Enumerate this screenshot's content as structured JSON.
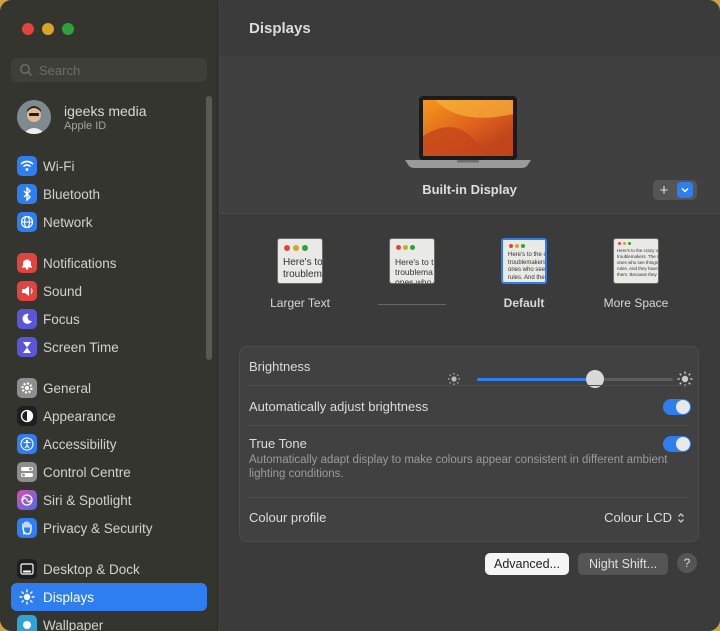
{
  "sidebar": {
    "search_placeholder": "Search",
    "account": {
      "name": "igeeks media",
      "subtitle": "Apple ID"
    },
    "groups": [
      [
        {
          "label": "Wi-Fi",
          "icon": "wifi-icon",
          "color": "#2f7ef0"
        },
        {
          "label": "Bluetooth",
          "icon": "bluetooth-icon",
          "color": "#2f7ef0"
        },
        {
          "label": "Network",
          "icon": "globe-icon",
          "color": "#2f7ef0"
        }
      ],
      [
        {
          "label": "Notifications",
          "icon": "bell-icon",
          "color": "#e0443e"
        },
        {
          "label": "Sound",
          "icon": "speaker-icon",
          "color": "#e0443e"
        },
        {
          "label": "Focus",
          "icon": "moon-icon",
          "color": "#5b55d8"
        },
        {
          "label": "Screen Time",
          "icon": "hourglass-icon",
          "color": "#5b55d8"
        }
      ],
      [
        {
          "label": "General",
          "icon": "gear-icon",
          "color": "#8e8e8e"
        },
        {
          "label": "Appearance",
          "icon": "appearance-icon",
          "color": "#1f1f1f"
        },
        {
          "label": "Accessibility",
          "icon": "accessibility-icon",
          "color": "#2f7ef0"
        },
        {
          "label": "Control Centre",
          "icon": "switches-icon",
          "color": "#8e8e8e"
        },
        {
          "label": "Siri & Spotlight",
          "icon": "siri-icon",
          "color": "#b44bd6"
        },
        {
          "label": "Privacy & Security",
          "icon": "hand-icon",
          "color": "#2f7ef0"
        }
      ],
      [
        {
          "label": "Desktop & Dock",
          "icon": "dock-icon",
          "color": "#1f1f1f"
        },
        {
          "label": "Displays",
          "icon": "sun-icon",
          "color": "#2f7ef0",
          "selected": true
        },
        {
          "label": "Wallpaper",
          "icon": "wallpaper-icon",
          "color": "#2fa3d6"
        }
      ]
    ]
  },
  "main": {
    "title": "Displays",
    "display_name": "Built-in Display",
    "add_label": "+",
    "resolutions": [
      {
        "label": "Larger Text",
        "preview": "Here's to\ntroublem"
      },
      {
        "label": "",
        "preview": "Here's to t\ntroublema\nones who"
      },
      {
        "label": "Default",
        "preview": "Here's to the c\ntroublemakers.\nones who see\nrules. And the\nthem. We see",
        "active": true
      },
      {
        "label": "More Space",
        "preview": "Here's to the crazy one\ntroublemakers. The rou\nones who see things di\nrules. And they have no\nthem. Because they cha"
      }
    ],
    "brightness": {
      "label": "Brightness",
      "level": 0.6
    },
    "auto_brightness": {
      "label": "Automatically adjust brightness",
      "on": true
    },
    "true_tone": {
      "label": "True Tone",
      "description": "Automatically adapt display to make colours appear consistent in different ambient lighting conditions.",
      "on": true
    },
    "colour_profile": {
      "label": "Colour profile",
      "value": "Colour LCD"
    },
    "buttons": {
      "advanced": "Advanced...",
      "night_shift": "Night Shift...",
      "help": "?"
    }
  }
}
